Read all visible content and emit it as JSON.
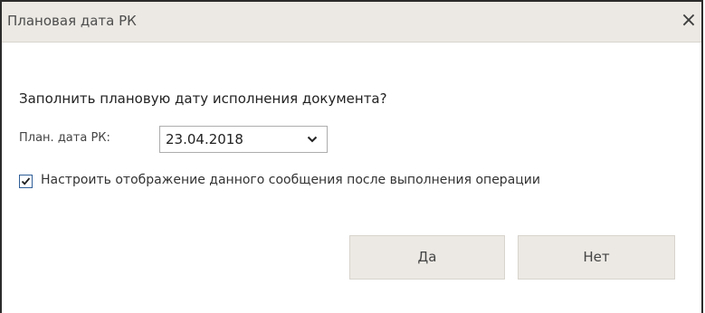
{
  "dialog": {
    "title": "Плановая дата РК",
    "close_icon": "×",
    "question": "Заполнить плановую дату исполнения документа?",
    "date_label": "План. дата РК:",
    "date_value": "23.04.2018",
    "checkbox_checked": true,
    "checkbox_label": "Настроить отображение данного сообщения после выполнения операции",
    "yes_label": "Да",
    "no_label": "Нет"
  },
  "colors": {
    "titlebar": "#ece9e4",
    "button": "#ece9e4",
    "checkbox_accent": "#2f5f98"
  }
}
